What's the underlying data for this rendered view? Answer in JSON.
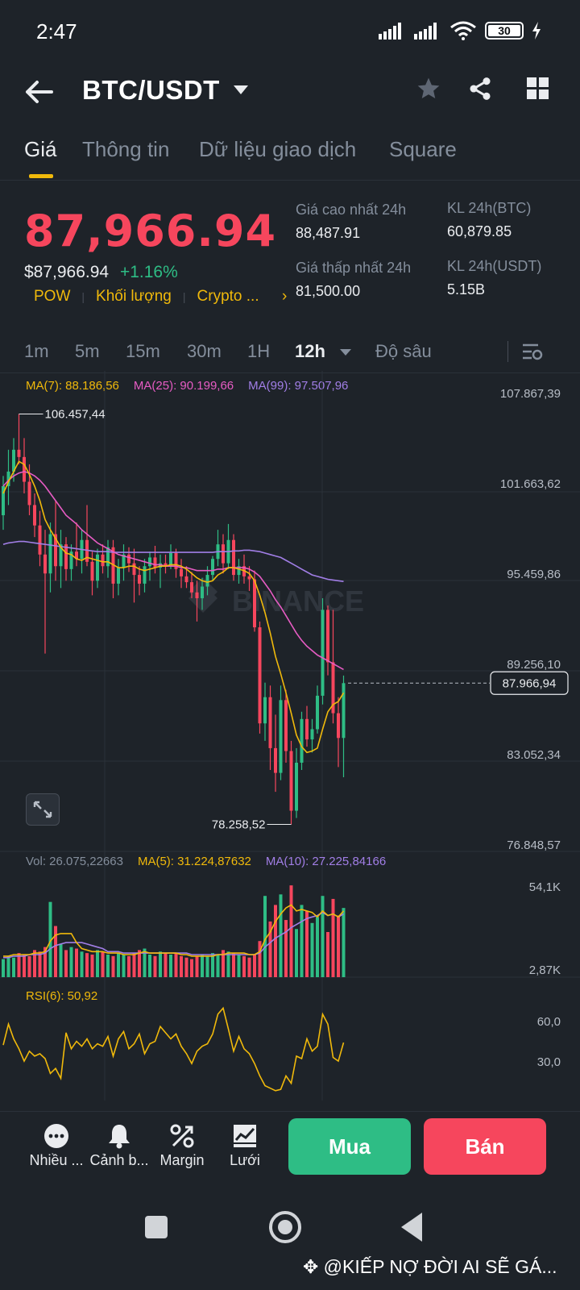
{
  "status": {
    "time": "2:47",
    "battery": "30"
  },
  "header": {
    "pair": "BTC/USDT"
  },
  "tabs": [
    {
      "label": "Giá"
    },
    {
      "label": "Thông tin"
    },
    {
      "label": "Dữ liệu giao dịch"
    },
    {
      "label": "Square"
    }
  ],
  "price": {
    "main": "87,966.94",
    "usd": "$87,966.94",
    "change": "+1.16%",
    "tags": [
      "POW",
      "Khối lượng",
      "Crypto ..."
    ]
  },
  "stats": {
    "high_label": "Giá cao nhất 24h",
    "high_value": "88,487.91",
    "low_label": "Giá thấp nhất 24h",
    "low_value": "81,500.00",
    "vol_btc_label": "KL 24h(BTC)",
    "vol_btc_value": "60,879.85",
    "vol_usdt_label": "KL 24h(USDT)",
    "vol_usdt_value": "5.15B"
  },
  "intervals": [
    "1m",
    "5m",
    "15m",
    "30m",
    "1H",
    "12h",
    "Độ sâu"
  ],
  "indicators": {
    "ma7": "MA(7): 88.186,56",
    "ma25": "MA(25): 90.199,66",
    "ma99": "MA(99): 97.507,96",
    "vol": "Vol: 26.075,22663",
    "vol_ma5": "MA(5): 31.224,87632",
    "vol_ma10": "MA(10): 27.225,84166",
    "rsi": "RSI(6): 50,92"
  },
  "chart_labels": {
    "price_axis": [
      "107.867,39",
      "101.663,62",
      "95.459,86",
      "89.256,10",
      "83.052,34",
      "76.848,57"
    ],
    "current": "87.966,94",
    "high_mark": "106.457,44",
    "low_mark": "78.258,52",
    "vol_axis": [
      "54,1K",
      "2,87K"
    ],
    "rsi_axis": [
      "60,0",
      "30,0"
    ],
    "watermark": "BINANCE"
  },
  "toolbar": {
    "more": "Nhiều ...",
    "alert": "Cảnh b...",
    "margin": "Margin",
    "grid": "Lưới",
    "buy": "Mua",
    "sell": "Bán"
  },
  "footer": {
    "watermark": "@KIẾP NỢ ĐỜI AI SẼ GÁ..."
  },
  "colors": {
    "up": "#2ebd85",
    "down": "#f6465d",
    "accent": "#f0b90b",
    "bg": "#1e2329"
  },
  "chart_data": {
    "type": "candlestick",
    "price_ylim": [
      76848.57,
      107867.39
    ],
    "candles": [
      {
        "o": 99500,
        "h": 102200,
        "l": 98500,
        "c": 101500
      },
      {
        "o": 101500,
        "h": 104000,
        "l": 100200,
        "c": 102500
      },
      {
        "o": 102500,
        "h": 104800,
        "l": 101800,
        "c": 104000
      },
      {
        "o": 104000,
        "h": 106457,
        "l": 103000,
        "c": 103500
      },
      {
        "o": 103500,
        "h": 104800,
        "l": 101000,
        "c": 101800
      },
      {
        "o": 101800,
        "h": 103000,
        "l": 99500,
        "c": 100200
      },
      {
        "o": 100200,
        "h": 101000,
        "l": 98000,
        "c": 98800
      },
      {
        "o": 98800,
        "h": 99800,
        "l": 96000,
        "c": 96800
      },
      {
        "o": 96800,
        "h": 98500,
        "l": 90000,
        "c": 95500
      },
      {
        "o": 95500,
        "h": 99000,
        "l": 94200,
        "c": 98200
      },
      {
        "o": 98200,
        "h": 100500,
        "l": 95000,
        "c": 96000
      },
      {
        "o": 96000,
        "h": 98500,
        "l": 94500,
        "c": 97500
      },
      {
        "o": 97500,
        "h": 98000,
        "l": 95000,
        "c": 95800
      },
      {
        "o": 95800,
        "h": 97500,
        "l": 95000,
        "c": 97000
      },
      {
        "o": 97000,
        "h": 99000,
        "l": 96000,
        "c": 96500
      },
      {
        "o": 96500,
        "h": 98500,
        "l": 95500,
        "c": 97800
      },
      {
        "o": 97800,
        "h": 100200,
        "l": 96000,
        "c": 96300
      },
      {
        "o": 96300,
        "h": 97000,
        "l": 94000,
        "c": 95000
      },
      {
        "o": 95000,
        "h": 97200,
        "l": 94500,
        "c": 96800
      },
      {
        "o": 96800,
        "h": 97500,
        "l": 95500,
        "c": 96000
      },
      {
        "o": 96000,
        "h": 97800,
        "l": 95200,
        "c": 97300
      },
      {
        "o": 97300,
        "h": 97800,
        "l": 93800,
        "c": 94800
      },
      {
        "o": 94800,
        "h": 96500,
        "l": 94000,
        "c": 95900
      },
      {
        "o": 95900,
        "h": 97500,
        "l": 95000,
        "c": 96800
      },
      {
        "o": 96800,
        "h": 97300,
        "l": 95600,
        "c": 96200
      },
      {
        "o": 96200,
        "h": 97200,
        "l": 93500,
        "c": 95400
      },
      {
        "o": 95400,
        "h": 96000,
        "l": 94000,
        "c": 94800
      },
      {
        "o": 94800,
        "h": 96500,
        "l": 94200,
        "c": 96000
      },
      {
        "o": 96000,
        "h": 97000,
        "l": 95000,
        "c": 96600
      },
      {
        "o": 96600,
        "h": 97400,
        "l": 95500,
        "c": 95900
      },
      {
        "o": 95900,
        "h": 96800,
        "l": 94500,
        "c": 96200
      },
      {
        "o": 96200,
        "h": 96800,
        "l": 95500,
        "c": 96000
      },
      {
        "o": 96000,
        "h": 97500,
        "l": 95800,
        "c": 96900
      },
      {
        "o": 96900,
        "h": 97200,
        "l": 95200,
        "c": 95800
      },
      {
        "o": 95800,
        "h": 96500,
        "l": 94500,
        "c": 95300
      },
      {
        "o": 95300,
        "h": 96000,
        "l": 94500,
        "c": 94900
      },
      {
        "o": 94900,
        "h": 95600,
        "l": 93800,
        "c": 94200
      },
      {
        "o": 94200,
        "h": 95000,
        "l": 92200,
        "c": 93800
      },
      {
        "o": 93800,
        "h": 95200,
        "l": 93000,
        "c": 94600
      },
      {
        "o": 94600,
        "h": 96000,
        "l": 94000,
        "c": 95400
      },
      {
        "o": 95400,
        "h": 96700,
        "l": 95000,
        "c": 96500
      },
      {
        "o": 96500,
        "h": 98500,
        "l": 96000,
        "c": 97500
      },
      {
        "o": 97500,
        "h": 98200,
        "l": 95500,
        "c": 96200
      },
      {
        "o": 96200,
        "h": 98900,
        "l": 95800,
        "c": 97800
      },
      {
        "o": 97800,
        "h": 98200,
        "l": 95000,
        "c": 95400
      },
      {
        "o": 95400,
        "h": 96500,
        "l": 94800,
        "c": 96000
      },
      {
        "o": 96000,
        "h": 96800,
        "l": 94800,
        "c": 95300
      },
      {
        "o": 95300,
        "h": 96000,
        "l": 94300,
        "c": 95100
      },
      {
        "o": 95100,
        "h": 95700,
        "l": 91500,
        "c": 91800
      },
      {
        "o": 91800,
        "h": 92200,
        "l": 84500,
        "c": 85200
      },
      {
        "o": 85200,
        "h": 88000,
        "l": 84000,
        "c": 87000
      },
      {
        "o": 87000,
        "h": 87800,
        "l": 82000,
        "c": 83500
      },
      {
        "o": 83500,
        "h": 85800,
        "l": 80500,
        "c": 81800
      },
      {
        "o": 81800,
        "h": 87800,
        "l": 81300,
        "c": 86800
      },
      {
        "o": 86800,
        "h": 87500,
        "l": 82500,
        "c": 83300
      },
      {
        "o": 83300,
        "h": 84000,
        "l": 78258,
        "c": 79200
      },
      {
        "o": 79200,
        "h": 83500,
        "l": 78700,
        "c": 82500
      },
      {
        "o": 82500,
        "h": 86000,
        "l": 82000,
        "c": 85500
      },
      {
        "o": 85500,
        "h": 86400,
        "l": 83600,
        "c": 84100
      },
      {
        "o": 84100,
        "h": 85500,
        "l": 83200,
        "c": 84800
      },
      {
        "o": 84800,
        "h": 87800,
        "l": 84500,
        "c": 87100
      },
      {
        "o": 87100,
        "h": 93800,
        "l": 86500,
        "c": 93000
      },
      {
        "o": 93000,
        "h": 93300,
        "l": 88500,
        "c": 89400
      },
      {
        "o": 89400,
        "h": 93000,
        "l": 85200,
        "c": 85900
      },
      {
        "o": 85900,
        "h": 87000,
        "l": 82200,
        "c": 84200
      },
      {
        "o": 84200,
        "h": 88487,
        "l": 81500,
        "c": 87967
      }
    ],
    "ma7": [
      101000,
      101800,
      102500,
      103200,
      103000,
      102300,
      101500,
      100500,
      99200,
      98500,
      97900,
      97300,
      96900,
      96800,
      96500,
      96400,
      96600,
      96500,
      96400,
      96300,
      96300,
      96100,
      95900,
      95900,
      96000,
      96000,
      95800,
      95700,
      95800,
      95900,
      96000,
      96000,
      96100,
      96100,
      96000,
      95800,
      95500,
      95200,
      95000,
      94900,
      95000,
      95400,
      95600,
      95900,
      95900,
      95800,
      95700,
      95500,
      95000,
      94000,
      92800,
      91400,
      89800,
      88600,
      87300,
      85900,
      84400,
      83600,
      83200,
      83300,
      83500,
      84800,
      86000,
      86500,
      86700,
      87300
    ],
    "ma25": [
      101500,
      101900,
      102200,
      102400,
      102500,
      102400,
      102200,
      101900,
      101500,
      101000,
      100500,
      100000,
      99500,
      99200,
      98900,
      98500,
      98200,
      97900,
      97600,
      97400,
      97200,
      97000,
      96800,
      96700,
      96600,
      96500,
      96400,
      96300,
      96200,
      96100,
      96100,
      96000,
      96000,
      96000,
      95900,
      95900,
      95800,
      95700,
      95700,
      95700,
      95700,
      95800,
      95800,
      95900,
      95900,
      95900,
      95900,
      95800,
      95600,
      95300,
      94800,
      94300,
      93700,
      93200,
      92600,
      92000,
      91400,
      90900,
      90500,
      90200,
      89900,
      89700,
      89500,
      89300,
      89100,
      88900
    ],
    "ma99": [
      97500,
      97600,
      97650,
      97700,
      97700,
      97650,
      97600,
      97550,
      97500,
      97450,
      97400,
      97350,
      97300,
      97250,
      97200,
      97150,
      97100,
      97050,
      97000,
      97000,
      97000,
      96950,
      96950,
      96950,
      96950,
      96950,
      96950,
      96950,
      96950,
      96950,
      96950,
      96950,
      96950,
      96950,
      96950,
      96950,
      96950,
      96950,
      96950,
      96950,
      96950,
      97000,
      97000,
      97000,
      97050,
      97050,
      97100,
      97100,
      97050,
      97000,
      96900,
      96800,
      96700,
      96600,
      96400,
      96200,
      96000,
      95800,
      95600,
      95400,
      95300,
      95200,
      95100,
      95050,
      95000,
      94950
    ],
    "volume": [
      12,
      14,
      13,
      16,
      15,
      14,
      18,
      17,
      20,
      50,
      34,
      22,
      18,
      20,
      19,
      17,
      16,
      15,
      18,
      17,
      15,
      14,
      16,
      15,
      14,
      16,
      18,
      19,
      15,
      14,
      17,
      16,
      15,
      16,
      14,
      13,
      12,
      14,
      15,
      14,
      16,
      15,
      18,
      17,
      16,
      15,
      14,
      13,
      15,
      24,
      54,
      37,
      48,
      55,
      38,
      61,
      32,
      48,
      44,
      36,
      40,
      54,
      30,
      52,
      41,
      46
    ],
    "vol_ma5": [
      14,
      14,
      15,
      15,
      15,
      15,
      16,
      16,
      17,
      24,
      28,
      29,
      29,
      29,
      23,
      19,
      18,
      17,
      17,
      17,
      16,
      16,
      16,
      15,
      15,
      15,
      16,
      17,
      16,
      16,
      16,
      16,
      16,
      16,
      15,
      15,
      14,
      14,
      14,
      14,
      14,
      15,
      15,
      16,
      16,
      16,
      16,
      15,
      15,
      17,
      25,
      30,
      37,
      42,
      46,
      48,
      44,
      45,
      44,
      43,
      40,
      44,
      41,
      42,
      40,
      44
    ],
    "vol_ma10": [
      13,
      13,
      14,
      14,
      14,
      15,
      15,
      15,
      16,
      19,
      21,
      22,
      23,
      23,
      23,
      23,
      22,
      21,
      20,
      19,
      17,
      17,
      17,
      16,
      16,
      16,
      16,
      16,
      16,
      16,
      16,
      16,
      16,
      16,
      16,
      16,
      15,
      15,
      15,
      15,
      15,
      15,
      15,
      15,
      15,
      15,
      15,
      15,
      15,
      16,
      20,
      23,
      26,
      28,
      30,
      33,
      35,
      37,
      39,
      40,
      41,
      43,
      41,
      42,
      40,
      42
    ],
    "rsi": [
      45,
      62,
      50,
      42,
      32,
      40,
      36,
      38,
      34,
      22,
      26,
      18,
      55,
      42,
      48,
      44,
      50,
      42,
      46,
      44,
      52,
      36,
      50,
      56,
      42,
      46,
      54,
      38,
      46,
      48,
      60,
      55,
      50,
      54,
      44,
      38,
      30,
      40,
      44,
      46,
      54,
      70,
      75,
      58,
      40,
      52,
      42,
      38,
      30,
      20,
      12,
      10,
      8,
      9,
      20,
      14,
      36,
      34,
      50,
      40,
      44,
      70,
      62,
      35,
      32,
      47
    ]
  }
}
